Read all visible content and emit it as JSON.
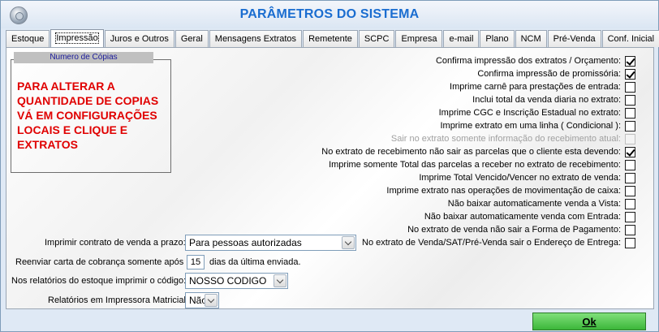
{
  "window": {
    "title": "PARÂMETROS DO SISTEMA",
    "app_icon": "gear-icon"
  },
  "tabs": [
    {
      "label": "Estoque",
      "active": false
    },
    {
      "label": "Impressão",
      "active": true
    },
    {
      "label": "Juros e Outros",
      "active": false
    },
    {
      "label": "Geral",
      "active": false
    },
    {
      "label": "Mensagens Extratos",
      "active": false
    },
    {
      "label": "Remetente",
      "active": false
    },
    {
      "label": "SCPC",
      "active": false
    },
    {
      "label": "Empresa",
      "active": false
    },
    {
      "label": "e-mail",
      "active": false
    },
    {
      "label": "Plano",
      "active": false
    },
    {
      "label": "NCM",
      "active": false
    },
    {
      "label": "Pré-Venda",
      "active": false
    },
    {
      "label": "Conf. Inicial",
      "active": false
    }
  ],
  "copies_group": {
    "title": "Numero de Cópias",
    "message": "PARA ALTERAR A QUANTIDADE DE COPIAS VÁ EM CONFIGURAÇÕES LOCAIS E CLIQUE E EXTRATOS"
  },
  "options": [
    {
      "label": "Confirma impressão dos extratos / Orçamento:",
      "checked": true,
      "disabled": false
    },
    {
      "label": "Confirma impressão de promissória:",
      "checked": true,
      "disabled": false
    },
    {
      "label": "Imprime carnê para prestações de entrada:",
      "checked": false,
      "disabled": false
    },
    {
      "label": "Inclui total da venda diaria no extrato:",
      "checked": false,
      "disabled": false
    },
    {
      "label": "Imprime CGC e Inscrição Estadual no extrato:",
      "checked": false,
      "disabled": false
    },
    {
      "label": "Imprime extrato em uma linha ( Condicional ):",
      "checked": false,
      "disabled": false
    },
    {
      "label": "Sair no extrato somente informação do recebimento atual:",
      "checked": false,
      "disabled": true
    },
    {
      "label": "No extrato de recebimento não sair as parcelas que o cliente esta devendo:",
      "checked": true,
      "disabled": false
    },
    {
      "label": "Imprime somente Total das parcelas a receber no extrato de recebimento:",
      "checked": false,
      "disabled": false
    },
    {
      "label": "Imprime Total Vencido/Vencer no extrato de venda:",
      "checked": false,
      "disabled": false
    },
    {
      "label": "Imprime extrato nas operações de movimentação de caixa:",
      "checked": false,
      "disabled": false
    },
    {
      "label": "Não baixar automaticamente venda a Vista:",
      "checked": false,
      "disabled": false
    },
    {
      "label": "Não baixar automaticamente venda com Entrada:",
      "checked": false,
      "disabled": false
    },
    {
      "label": "No extrato de venda não sair a Forma de Pagamento:",
      "checked": false,
      "disabled": false
    },
    {
      "label": "No extrato de Venda/SAT/Pré-Venda sair o Endereço de Entrega:",
      "checked": false,
      "disabled": false
    }
  ],
  "form": {
    "contract_label": "Imprimir contrato de venda a prazo:",
    "contract_value": "Para pessoas autorizadas",
    "resend_label": "Reenviar carta de cobrança somente após",
    "resend_value": "15",
    "resend_suffix": "dias da última enviada.",
    "code_label": "Nos relatórios do estoque imprimir o código:",
    "code_value": "NOSSO CODIGO",
    "matrix_label": "Relatórios em Impressora Matricial:",
    "matrix_value": "Não"
  },
  "ok_button": {
    "label": "Ok"
  }
}
